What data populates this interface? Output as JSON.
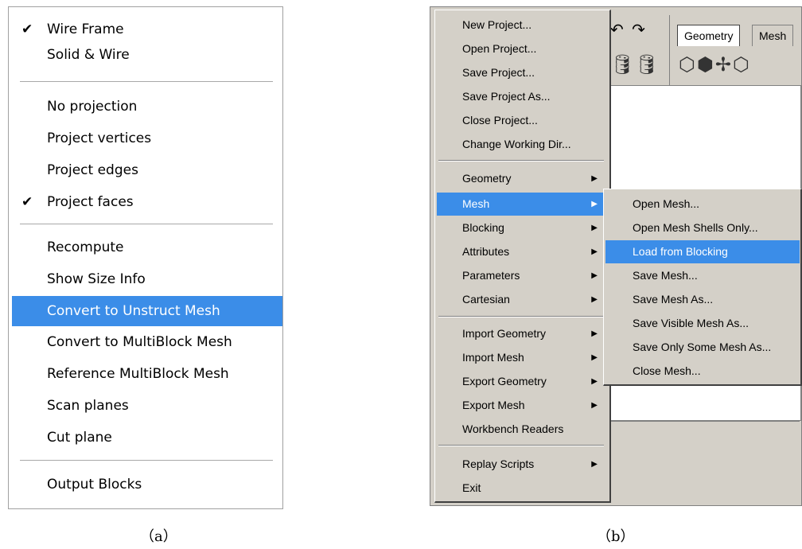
{
  "panel_a": {
    "items": [
      {
        "label": "Wire Frame",
        "checked": true
      },
      {
        "label": "Solid & Wire",
        "checked": false
      },
      {
        "label": "No projection",
        "checked": false
      },
      {
        "label": "Project vertices",
        "checked": false
      },
      {
        "label": "Project edges",
        "checked": false
      },
      {
        "label": "Project faces",
        "checked": true
      },
      {
        "label": "Recompute",
        "checked": false
      },
      {
        "label": "Show Size Info",
        "checked": false
      },
      {
        "label": "Convert to Unstruct Mesh",
        "checked": false,
        "selected": true
      },
      {
        "label": "Convert to MultiBlock Mesh",
        "checked": false
      },
      {
        "label": "Reference MultiBlock Mesh",
        "checked": false
      },
      {
        "label": "Scan planes",
        "checked": false
      },
      {
        "label": "Cut plane",
        "checked": false
      },
      {
        "label": "Output Blocks",
        "checked": false
      }
    ],
    "check_glyph": "✔",
    "caption": "（a）"
  },
  "panel_b": {
    "tabs": [
      "Geometry",
      "Mesh"
    ],
    "undo_redo": "↶ ↷",
    "toolbar_icons_left": "🛢🛢",
    "toolbar_icons_right": "⬡⬢✢⬡",
    "file_menu": [
      {
        "label": "New Project..."
      },
      {
        "label": "Open Project..."
      },
      {
        "label": "Save Project..."
      },
      {
        "label": "Save Project As..."
      },
      {
        "label": "Close Project..."
      },
      {
        "label": "Change Working Dir..."
      },
      {
        "label": "Geometry",
        "submenu": true
      },
      {
        "label": "Mesh",
        "submenu": true,
        "selected": true
      },
      {
        "label": "Blocking",
        "submenu": true
      },
      {
        "label": "Attributes",
        "submenu": true
      },
      {
        "label": "Parameters",
        "submenu": true
      },
      {
        "label": "Cartesian",
        "submenu": true
      },
      {
        "label": "Import Geometry",
        "submenu": true
      },
      {
        "label": "Import Mesh",
        "submenu": true
      },
      {
        "label": "Export Geometry",
        "submenu": true
      },
      {
        "label": "Export Mesh",
        "submenu": true
      },
      {
        "label": "Workbench Readers"
      },
      {
        "label": "Replay Scripts",
        "submenu": true
      },
      {
        "label": "Exit"
      }
    ],
    "mesh_submenu": [
      {
        "label": "Open Mesh..."
      },
      {
        "label": "Open Mesh Shells Only..."
      },
      {
        "label": "Load from Blocking",
        "selected": true
      },
      {
        "label": "Save Mesh..."
      },
      {
        "label": "Save Mesh As..."
      },
      {
        "label": "Save Visible Mesh As..."
      },
      {
        "label": "Save Only Some Mesh As..."
      },
      {
        "label": "Close Mesh..."
      }
    ],
    "arrow_glyph": "▶",
    "caption": "（b）"
  },
  "colors": {
    "highlight": "#3b8de8",
    "menu_bg": "#d4d0c8"
  }
}
